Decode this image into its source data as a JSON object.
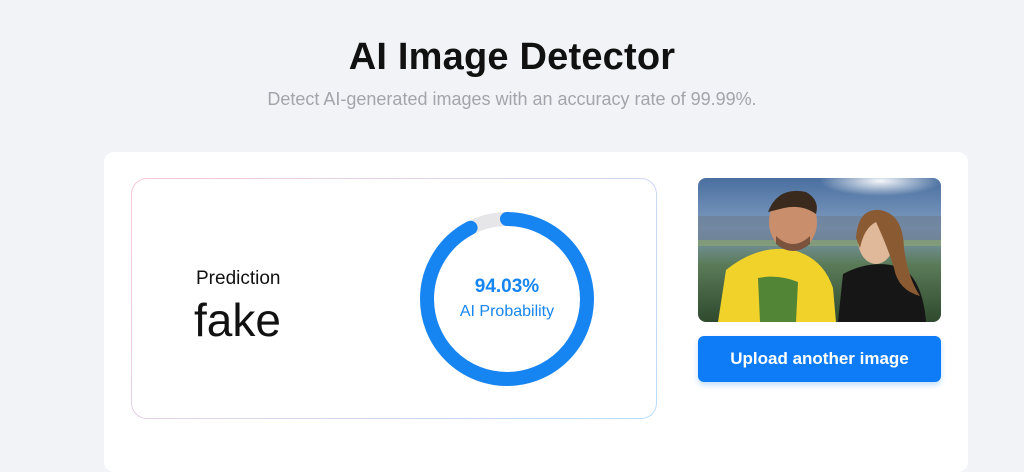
{
  "header": {
    "title": "AI Image Detector",
    "subtitle": "Detect AI-generated images with an accuracy rate of 99.99%."
  },
  "result": {
    "prediction_label": "Prediction",
    "prediction_value": "fake",
    "probability_text": "94.03%",
    "probability_value": 0.9403,
    "probability_label": "AI Probability"
  },
  "upload": {
    "button_label": "Upload another image"
  },
  "colors": {
    "accent": "#1685f2",
    "button": "#0e7cf6",
    "ring_track": "#e6e6e8",
    "page_background": "#f2f3f6"
  }
}
